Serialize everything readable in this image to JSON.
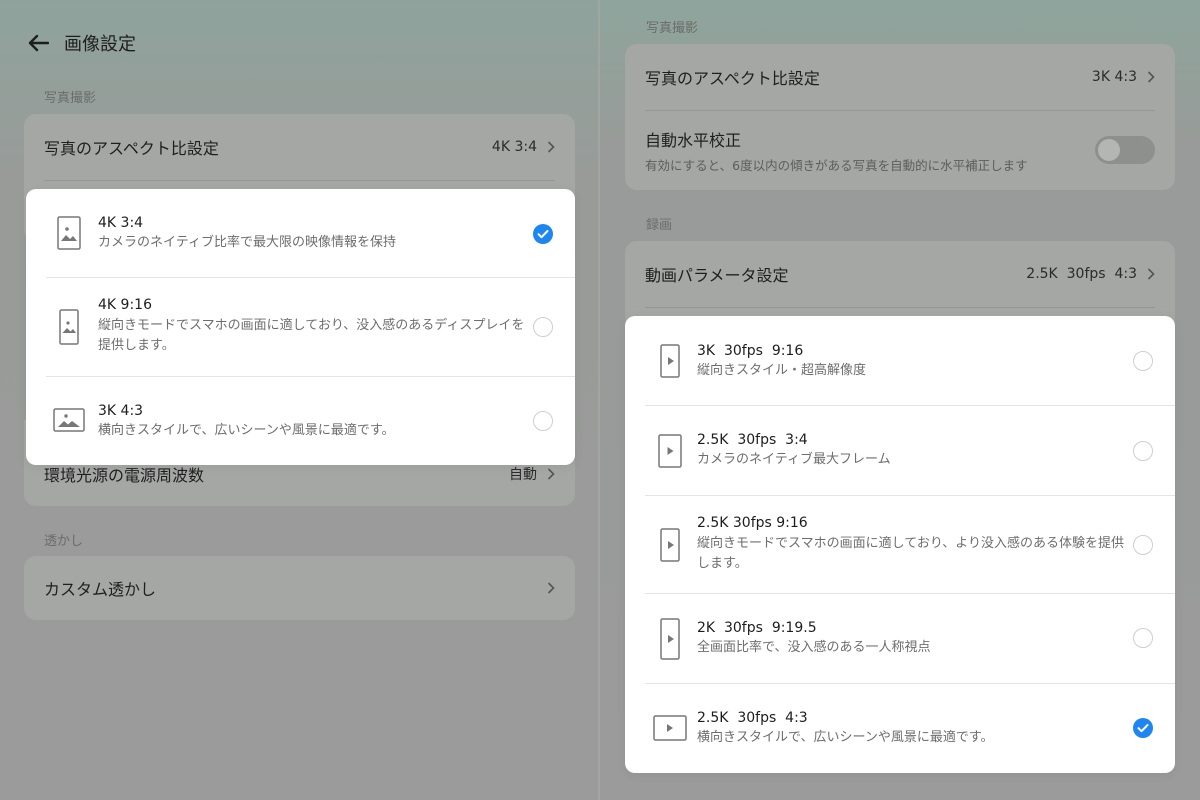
{
  "left": {
    "header": {
      "title": "画像設定"
    },
    "section_photo": "写真撮影",
    "aspect_row": {
      "label": "写真のアスペクト比設定",
      "value": "4K 3:4"
    },
    "power_row": {
      "label": "環境光源の電源周波数",
      "value": "自動"
    },
    "section_watermark": "透かし",
    "watermark_row": {
      "label": "カスタム透かし"
    },
    "popup": {
      "options": [
        {
          "title": "4K 3:4",
          "sub": "カメラのネイティブ比率で最大限の映像情報を保持",
          "selected": true
        },
        {
          "title": "4K 9:16",
          "sub": "縦向きモードでスマホの画面に適しており、没入感のあるディスプレイを提供します。",
          "selected": false
        },
        {
          "title": "3K 4:3",
          "sub": "横向きスタイルで、広いシーンや風景に最適です。",
          "selected": false
        }
      ]
    }
  },
  "right": {
    "section_photo": "写真撮影",
    "aspect_row": {
      "label": "写真のアスペクト比設定",
      "value": "3K 4:3"
    },
    "level_row": {
      "label": "自動水平校正",
      "sub": "有効にすると、6度以内の傾きがある写真を自動的に水平補正します",
      "enabled": false
    },
    "section_video": "録画",
    "video_row": {
      "label": "動画パラメータ設定",
      "value": "2.5K  30fps  4:3"
    },
    "popup": {
      "options": [
        {
          "title": "3K  30fps  9:16",
          "sub": "縦向きスタイル・超高解像度",
          "selected": false
        },
        {
          "title": "2.5K  30fps  3:4",
          "sub": "カメラのネイティブ最大フレーム",
          "selected": false
        },
        {
          "title": "2.5K 30fps 9:16",
          "sub": "縦向きモードでスマホの画面に適しており、より没入感のある体験を提供します。",
          "selected": false
        },
        {
          "title": "2K  30fps  9:19.5",
          "sub": "全画面比率で、没入感のある一人称視点",
          "selected": false
        },
        {
          "title": "2.5K  30fps  4:3",
          "sub": "横向きスタイルで、広いシーンや風景に最適です。",
          "selected": true
        }
      ]
    }
  },
  "colors": {
    "accent": "#1e86f0",
    "sheet_bg": "#ffffff",
    "dim_bg": "#9a9b9a"
  }
}
